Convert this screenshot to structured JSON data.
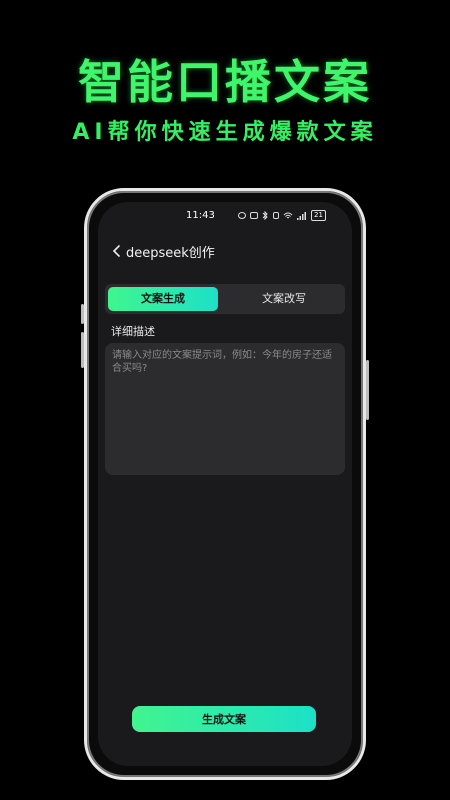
{
  "promo": {
    "headline": "智能口播文案",
    "subline": "AI帮你快速生成爆款文案",
    "accent_color": "#3ff56a"
  },
  "status_bar": {
    "time": "11:43",
    "icons": [
      "eye-icon",
      "nfc-icon",
      "bluetooth-icon",
      "vibrate-icon",
      "wifi-icon",
      "signal-icon"
    ],
    "battery": "21"
  },
  "nav": {
    "back_icon": "chevron-left-icon",
    "title": "deepseek创作"
  },
  "tabs": [
    {
      "label": "文案生成",
      "active": true
    },
    {
      "label": "文案改写",
      "active": false
    }
  ],
  "form": {
    "label": "详细描述",
    "placeholder": "请输入对应的文案提示词，例如：今年的房子还适合买吗?",
    "value": ""
  },
  "actions": {
    "generate_label": "生成文案",
    "gradient": [
      "#40f58e",
      "#1de0c8"
    ]
  }
}
